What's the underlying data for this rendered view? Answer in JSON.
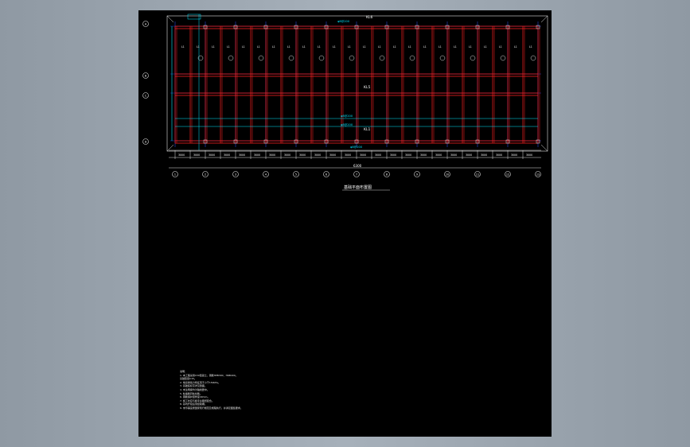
{
  "drawing": {
    "title": "基础平面布置图",
    "overall_dim": "6300",
    "bay_dims": [
      "3000",
      "3000",
      "3000",
      "3000",
      "3000",
      "3000",
      "3000",
      "3000",
      "3000",
      "3000",
      "3000",
      "3000",
      "3000",
      "3000",
      "3000",
      "3000",
      "3000",
      "3000",
      "3000",
      "3000",
      "3000",
      "3000",
      "3000",
      "3000"
    ],
    "bottom_axes": [
      "1",
      "2",
      "3",
      "4",
      "5",
      "6",
      "7",
      "8",
      "9",
      "10",
      "11",
      "12",
      "13"
    ],
    "left_axes": [
      "A",
      "B",
      "C",
      "D"
    ],
    "beam_labels": [
      "KL6",
      "KL5",
      "KL1"
    ],
    "rebar_labels": [
      "φ8@200",
      "φ8@200",
      "φ8@200",
      "φ8@200"
    ],
    "col_label": "L1",
    "colors": {
      "sheet": "#000000",
      "beam": "#ff2020",
      "rebar": "#00e5ff",
      "blue": "#3050ff",
      "line": "#e0e0e0",
      "text": "#ffffff"
    },
    "notes": [
      "说明：",
      "1. 本工程采用C30混凝土，钢筋HPB300、HRB400。",
      "   基础垫层C15。",
      "2. 地基承载力特征值不小于150kPa。",
      "3. 基础底标高详见剖面。",
      "4. 未注明梁均为轴线居中。",
      "5. 柱插筋同柱纵筋。",
      "6. 钢筋保护层厚度40mm。",
      "7. 施工时应与各专业图纸配合。",
      "8. 基坑开挖后须经验槽。",
      "9. 未尽事宜按国家现行规范及规程执行，并满足图集要求。"
    ]
  }
}
